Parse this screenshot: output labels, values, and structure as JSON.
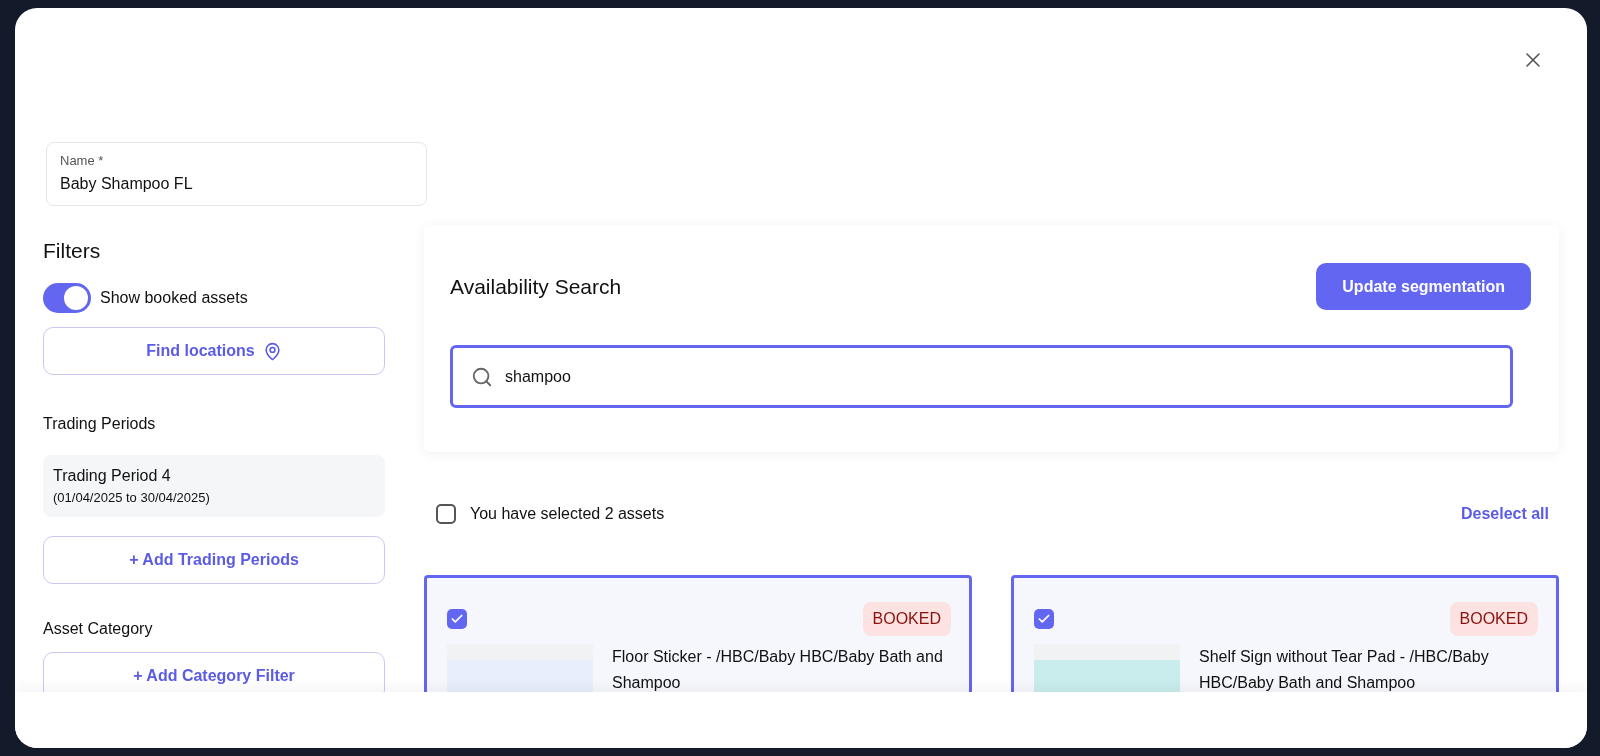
{
  "name_field": {
    "label": "Name *",
    "value": "Baby Shampoo FL"
  },
  "filters": {
    "title": "Filters",
    "show_booked": {
      "label": "Show booked assets",
      "on": true
    },
    "find_locations": "Find locations",
    "trading_periods": {
      "title": "Trading Periods",
      "items": [
        {
          "name": "Trading Period 4",
          "dates": "(01/04/2025 to 30/04/2025)"
        }
      ],
      "add_button": "+ Add Trading Periods"
    },
    "asset_category": {
      "title": "Asset Category",
      "add_button": "+ Add Category Filter"
    }
  },
  "availability": {
    "title": "Availability Search",
    "update_button": "Update segmentation",
    "search_value": "shampoo"
  },
  "selection": {
    "label": "You have selected 2 assets",
    "checked": false,
    "deselect": "Deselect all"
  },
  "assets": [
    {
      "selected": true,
      "badge": "BOOKED",
      "title": "Floor Sticker - /HBC/Baby HBC/Baby Bath and Shampoo"
    },
    {
      "selected": true,
      "badge": "BOOKED",
      "title": "Shelf Sign without Tear Pad - /HBC/Baby HBC/Baby Bath and Shampoo"
    }
  ]
}
